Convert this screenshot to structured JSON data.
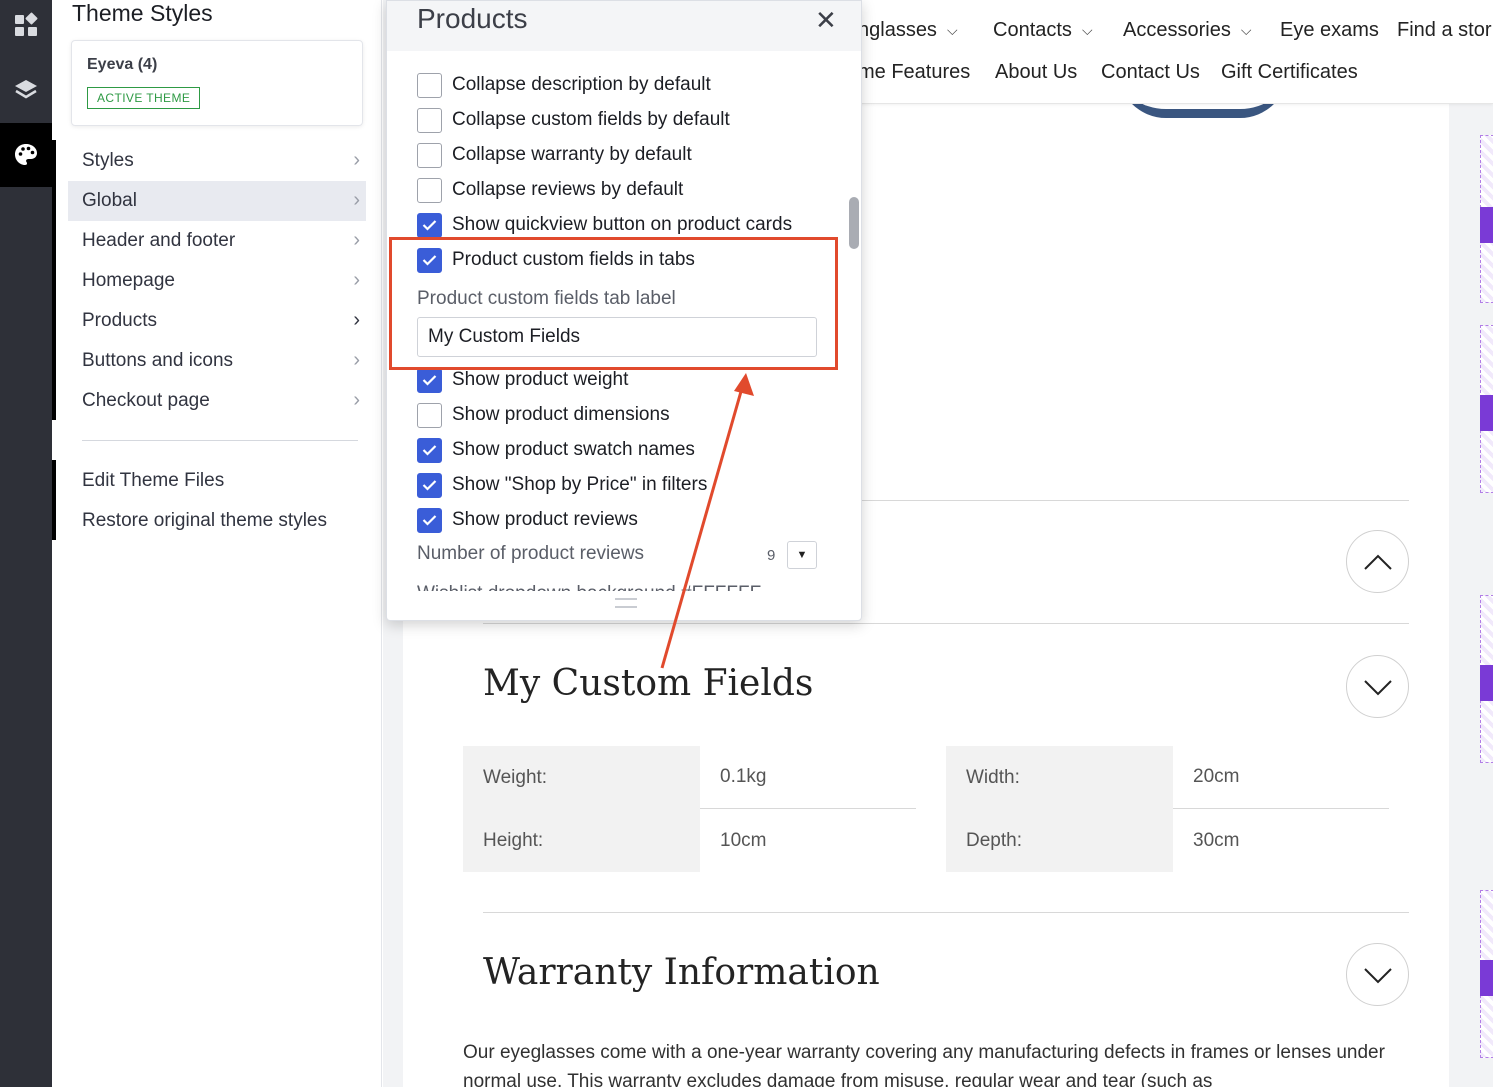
{
  "rail": {
    "icons": [
      "widgets-icon",
      "layers-icon",
      "palette-icon"
    ]
  },
  "panel": {
    "title": "Theme Styles",
    "theme_name": "Eyeva (4)",
    "theme_badge": "ACTIVE THEME",
    "menu": [
      {
        "label": "Styles"
      },
      {
        "label": "Global"
      },
      {
        "label": "Header and footer"
      },
      {
        "label": "Homepage"
      },
      {
        "label": "Products"
      },
      {
        "label": "Buttons and icons"
      },
      {
        "label": "Checkout page"
      }
    ],
    "edit_files": "Edit Theme Files",
    "restore": "Restore original theme styles"
  },
  "nav": {
    "row1": [
      "nglasses",
      "Contacts",
      "Accessories",
      "Eye exams",
      "Find a stor"
    ],
    "row2": [
      "me Features",
      "About Us",
      "Contact Us",
      "Gift Certificates"
    ]
  },
  "store": {
    "custom_fields_title": "My Custom Fields",
    "custom_fields": [
      {
        "label": "Weight:",
        "value": "0.1kg"
      },
      {
        "label": "Width:",
        "value": "20cm"
      },
      {
        "label": "Height:",
        "value": "10cm"
      },
      {
        "label": "Depth:",
        "value": "30cm"
      }
    ],
    "warranty_title": "Warranty Information",
    "warranty_text": "Our eyeglasses come with a one-year warranty covering any manufacturing defects in frames or lenses under normal use. This warranty excludes damage from misuse, regular wear and tear (such as"
  },
  "popup": {
    "title": "Products",
    "options": [
      {
        "label": "Collapse description by default",
        "checked": false
      },
      {
        "label": "Collapse custom fields by default",
        "checked": false
      },
      {
        "label": "Collapse warranty by default",
        "checked": false
      },
      {
        "label": "Collapse reviews by default",
        "checked": false
      },
      {
        "label": "Show quickview button on product cards",
        "checked": true
      },
      {
        "label": "Product custom fields in tabs",
        "checked": true
      }
    ],
    "tab_label_field": "Product custom fields tab label",
    "tab_label_value": "My Custom Fields",
    "options2": [
      {
        "label": "Show product weight",
        "checked": true
      },
      {
        "label": "Show product dimensions",
        "checked": false
      },
      {
        "label": "Show product swatch names",
        "checked": true
      },
      {
        "label": "Show \"Shop by Price\" in filters",
        "checked": true
      },
      {
        "label": "Show product reviews",
        "checked": true
      }
    ],
    "num_reviews_label": "Number of product reviews",
    "num_reviews_value": "9",
    "cut_label": "Wishlist dropdown background  #FFFFFF"
  },
  "colors": {
    "accent": "#3a5dd8",
    "annotation": "#e14a2d",
    "badge": "#2e9a44",
    "rail": "#2e3038"
  }
}
